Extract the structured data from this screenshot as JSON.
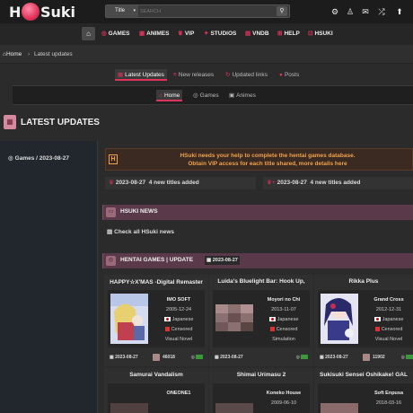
{
  "site": {
    "logo_h": "H",
    "logo_suki": "Suki"
  },
  "search": {
    "type_selected": "Title",
    "placeholder": "SEARCH"
  },
  "nav": {
    "items": [
      {
        "label": "GAMES",
        "icon": "gamepad-icon"
      },
      {
        "label": "ANIMES",
        "icon": "film-icon"
      },
      {
        "label": "VIP",
        "icon": "vip-icon"
      },
      {
        "label": "STUDIOS",
        "icon": "users-icon"
      },
      {
        "label": "VNDB",
        "icon": "book-icon"
      },
      {
        "label": "HELP",
        "icon": "plus-square-icon"
      },
      {
        "label": "HSUKI",
        "icon": "hsuki-icon"
      }
    ]
  },
  "breadcrumb": {
    "home": "Home",
    "current": "Latest updates"
  },
  "tabs_primary": [
    "Latest Updates",
    "New releases",
    "Updated links",
    "Posts"
  ],
  "tabs_secondary": [
    "Home",
    "Games",
    "Animes"
  ],
  "page_title": "LATEST UPDATES",
  "sidebar": {
    "item": "Games / 2023-08-27"
  },
  "notice": {
    "line1": "HSuki needs your help to complete the hentai games database.",
    "line2": "Obtain VIP access for each title shared, more details here"
  },
  "vip_updates": [
    {
      "date": "2023-08-27",
      "text": "4 new titles added"
    },
    {
      "date": "2023-08-27",
      "text": "4 new titles added"
    }
  ],
  "news": {
    "title": "HSUKI NEWS",
    "link": "Check all HSuki news"
  },
  "games_section": {
    "title": "HENTAI GAMES | UPDATE",
    "date": "2023-08-27"
  },
  "games": [
    {
      "title": "HAPPY☆X'MAS -Digital Remaster",
      "developer": "IMO SOFT",
      "release": "2005-12-24",
      "language": "Japanese",
      "censorship": "Censored",
      "genre": "Visual Novel",
      "updated": "2023-08-27",
      "views": "46018"
    },
    {
      "title": "Luida's Bluelight Bar: Hook Up,",
      "developer": "Moyori no Chi",
      "release": "2013-11-07",
      "language": "Japanese",
      "censorship": "Censored",
      "genre": "Simulation",
      "updated": "2023-08-27",
      "views": ""
    },
    {
      "title": "Rikka Plus",
      "developer": "Grand Cross",
      "release": "2012-12-31",
      "language": "Japanese",
      "censorship": "Censored",
      "genre": "Visual Novel",
      "updated": "2023-08-27",
      "views": "11902"
    },
    {
      "title": "Samurai Vandalism",
      "developer": "ONEONE1",
      "release": "",
      "language": "",
      "censorship": "",
      "genre": "",
      "updated": "",
      "views": ""
    },
    {
      "title": "Shimai Urimasu 2",
      "developer": "Koneko House",
      "release": "2009-06-10",
      "language": "",
      "censorship": "",
      "genre": "",
      "updated": "",
      "views": ""
    },
    {
      "title": "Sukisuki Sensei Oshikake! GAL",
      "developer": "Soft Enpusa",
      "release": "2018-03-16",
      "language": "",
      "censorship": "",
      "genre": "",
      "updated": "",
      "views": ""
    }
  ],
  "colors": {
    "accent": "#e0335a",
    "notice": "#f0a24a",
    "section": "#5a3a4a"
  }
}
